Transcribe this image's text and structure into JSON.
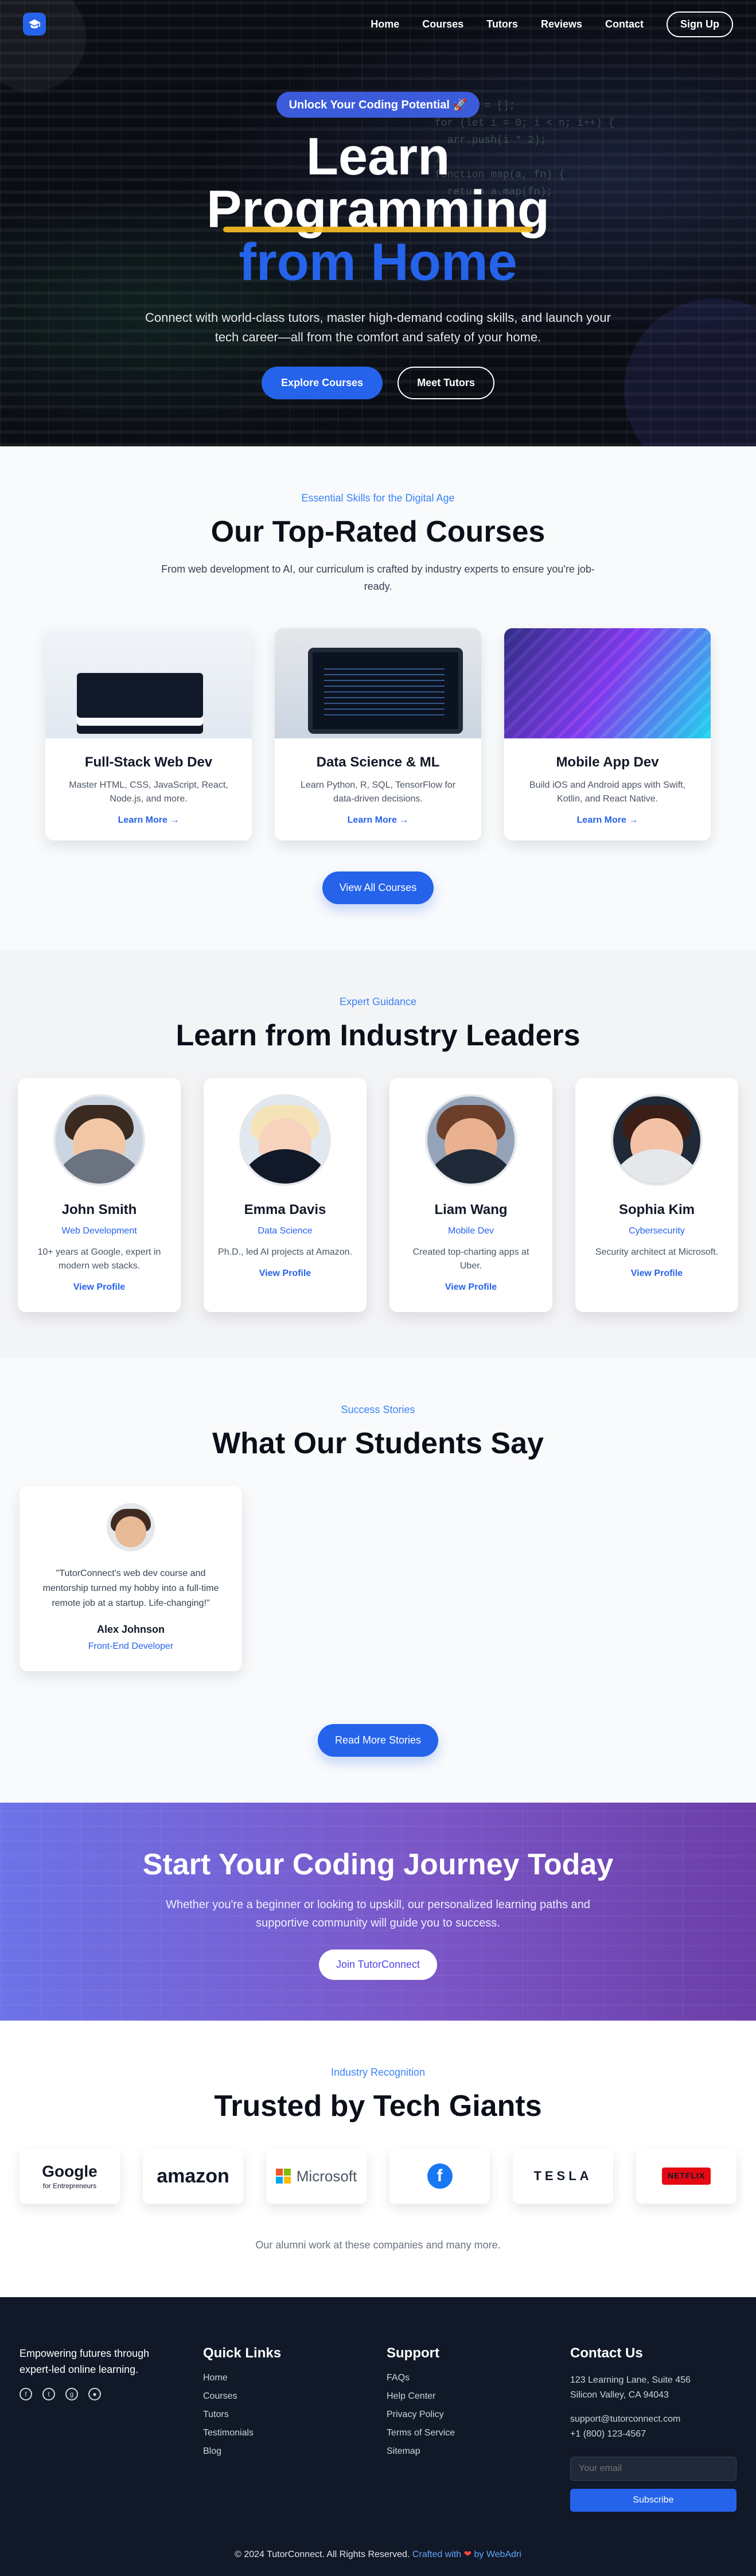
{
  "nav": {
    "links": [
      "Home",
      "Courses",
      "Tutors",
      "Reviews",
      "Contact"
    ],
    "signup": "Sign Up"
  },
  "hero": {
    "pill": "Unlock Your Coding Potential 🚀",
    "title_line1": "Learn",
    "title_line2": "Programming",
    "title_line3": "from Home",
    "subtitle": "Connect with world-class tutors, master high-demand coding skills, and launch your tech career—all from the comfort and safety of your home.",
    "cta_primary": "Explore Courses",
    "cta_secondary": "Meet Tutors"
  },
  "courses_section": {
    "eyebrow": "Essential Skills for the Digital Age",
    "title": "Our Top-Rated Courses",
    "description": "From web development to AI, our curriculum is crafted by industry experts to ensure you're job-ready.",
    "cards": [
      {
        "title": "Full-Stack Web Dev",
        "text": "Master HTML, CSS, JavaScript, React, Node.js, and more.",
        "link": "Learn More →"
      },
      {
        "title": "Data Science & ML",
        "text": "Learn Python, R, SQL, TensorFlow for data-driven decisions.",
        "link": "Learn More →"
      },
      {
        "title": "Mobile App Dev",
        "text": "Build iOS and Android apps with Swift, Kotlin, and React Native.",
        "link": "Learn More →"
      }
    ],
    "button": "View All Courses"
  },
  "tutors_section": {
    "eyebrow": "Expert Guidance",
    "title": "Learn from Industry Leaders",
    "tutors": [
      {
        "name": "John Smith",
        "role": "Web Development",
        "text": "10+ years at Google, expert in modern web stacks.",
        "link": "View Profile"
      },
      {
        "name": "Emma Davis",
        "role": "Data Science",
        "text": "Ph.D., led AI projects at Amazon.",
        "link": "View Profile"
      },
      {
        "name": "Liam Wang",
        "role": "Mobile Dev",
        "text": "Created top-charting apps at Uber.",
        "link": "View Profile"
      },
      {
        "name": "Sophia Kim",
        "role": "Cybersecurity",
        "text": "Security architect at Microsoft.",
        "link": "View Profile"
      }
    ]
  },
  "students_section": {
    "eyebrow": "Success Stories",
    "title": "What Our Students Say",
    "testimonial": {
      "quote": "\"TutorConnect's web dev course and mentorship turned my hobby into a full-time remote job at a startup. Life-changing!\"",
      "name": "Alex Johnson",
      "role": "Front-End Developer"
    },
    "button": "Read More Stories"
  },
  "cta_section": {
    "title": "Start Your Coding Journey Today",
    "subtitle": "Whether you're a beginner or looking to upskill, our personalized learning paths and supportive community will guide you to success.",
    "button": "Join TutorConnect"
  },
  "trusted_section": {
    "eyebrow": "Industry Recognition",
    "title": "Trusted by Tech Giants",
    "logos": [
      {
        "name": "Google",
        "sub": "for Entrepreneurs"
      },
      {
        "name": "amazon",
        "sub": ""
      },
      {
        "name": "Microsoft",
        "sub": ""
      },
      {
        "name": "f",
        "sub": ""
      },
      {
        "name": "TESLA",
        "sub": ""
      },
      {
        "name": "NETFLIX",
        "sub": ""
      }
    ],
    "note": "Our alumni work at these companies and many more."
  },
  "footer": {
    "brand_text": "Empowering futures through expert-led online learning.",
    "quick_links_title": "Quick Links",
    "quick_links": [
      "Home",
      "Courses",
      "Tutors",
      "Testimonials",
      "Blog"
    ],
    "support_title": "Support",
    "support_links": [
      "FAQs",
      "Help Center",
      "Privacy Policy",
      "Terms of Service",
      "Sitemap"
    ],
    "contact_title": "Contact Us",
    "address_line1": "123 Learning Lane, Suite 456",
    "address_line2": "Silicon Valley, CA 94043",
    "email": "support@tutorconnect.com",
    "phone": "+1 (800) 123-4567",
    "email_placeholder": "Your email",
    "subscribe": "Subscribe",
    "bottom_left": "© 2024 TutorConnect. All Rights Reserved.",
    "bottom_accent": "Crafted with",
    "bottom_by": "by WebAdri"
  },
  "colors": {
    "primary": "#2563eb",
    "accent_yellow": "#fbbf24",
    "footer_bg": "#111827"
  }
}
